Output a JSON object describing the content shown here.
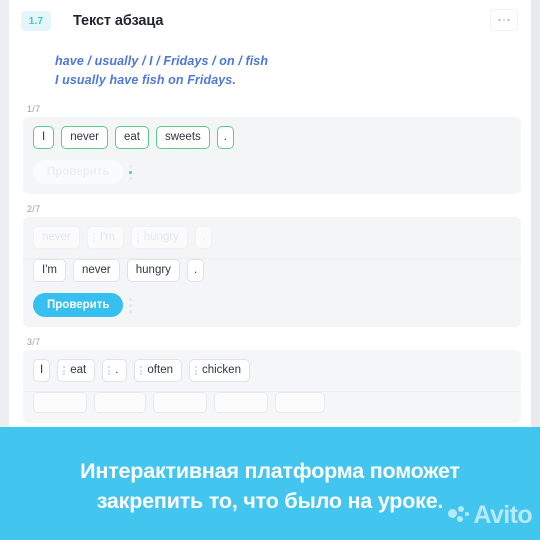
{
  "header": {
    "lesson_badge": "1.7",
    "title": "Текст абзаца",
    "more_icon": "more-horizontal-icon"
  },
  "example": {
    "scrambled": "have / usually / I / Fridays / on / fish",
    "answer": "I usually have fish on Fridays."
  },
  "exercises": [
    {
      "counter": "1/7",
      "state": "completed",
      "answer_chips": [
        "I",
        "never",
        "eat",
        "sweets",
        "."
      ],
      "check_label": "Проверить"
    },
    {
      "counter": "2/7",
      "state": "answered",
      "source_chips": [
        "never",
        "I'm",
        "hungry",
        "."
      ],
      "answer_chips": [
        "I'm",
        "never",
        "hungry",
        "."
      ],
      "check_label": "Проверить"
    },
    {
      "counter": "3/7",
      "state": "empty",
      "source_chips": [
        "I",
        "eat",
        ".",
        "often",
        "chicken"
      ],
      "slot_count": 5
    }
  ],
  "banner": {
    "line1": "Интерактивная платформа поможет",
    "line2": "закрепить то, что было на уроке.",
    "background_color": "#42c6f0"
  },
  "watermark": {
    "label": "Avito",
    "logo_icon": "avito-dots-icon"
  },
  "colors": {
    "accent_cyan": "#36c0ef",
    "correct_green": "#5ec98e",
    "example_blue": "#4a76d8",
    "badge_bg": "#e3f7fb"
  }
}
